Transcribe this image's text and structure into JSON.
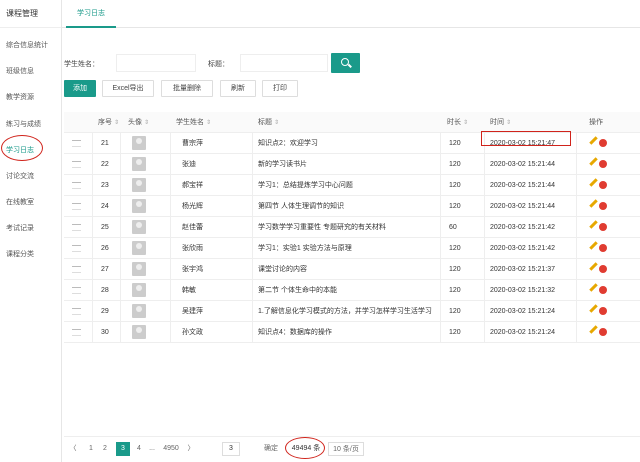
{
  "sidebar": {
    "title": "课程管理",
    "items": [
      {
        "label": "综合信息统计"
      },
      {
        "label": "班级信息"
      },
      {
        "label": "教学资源"
      },
      {
        "label": "练习与成绩"
      },
      {
        "label": "学习日志"
      },
      {
        "label": "讨论交流"
      },
      {
        "label": "在线教室"
      },
      {
        "label": "考试记录"
      },
      {
        "label": "课程分类"
      }
    ],
    "active_index": 4
  },
  "top_tab": {
    "label": "学习日志"
  },
  "search": {
    "student_label": "学生姓名：",
    "title_label": "标题：",
    "student_value": "",
    "title_value": ""
  },
  "toolbar": {
    "add": "添加",
    "excel": "Excel导出",
    "batch_delete": "批量删除",
    "refresh": "刷新",
    "print": "打印"
  },
  "table": {
    "headers": [
      "序号",
      "头像",
      "学生姓名",
      "标题",
      "时长",
      "时间",
      "操作"
    ],
    "rows": [
      {
        "no": "21",
        "name": "曹宗萍",
        "title": "知识点2：欢迎学习",
        "duration": "120",
        "time": "2020-03-02 15:21:47"
      },
      {
        "no": "22",
        "name": "张迪",
        "title": "新的学习读书片",
        "duration": "120",
        "time": "2020-03-02 15:21:44"
      },
      {
        "no": "23",
        "name": "郝宝祥",
        "title": "学习1：总结提炼学习中心问题",
        "duration": "120",
        "time": "2020-03-02 15:21:44"
      },
      {
        "no": "24",
        "name": "杨光辉",
        "title": "第四节 人体生理调节的知识",
        "duration": "120",
        "time": "2020-03-02 15:21:44"
      },
      {
        "no": "25",
        "name": "赵佳蕾",
        "title": "学习数学学习重要性 专题研究的有关材料",
        "duration": "60",
        "time": "2020-03-02 15:21:42"
      },
      {
        "no": "26",
        "name": "张欣雨",
        "title": "学习1：实验1 实验方法与原理",
        "duration": "120",
        "time": "2020-03-02 15:21:42"
      },
      {
        "no": "27",
        "name": "张宇鸿",
        "title": "课堂讨论的内容",
        "duration": "120",
        "time": "2020-03-02 15:21:37"
      },
      {
        "no": "28",
        "name": "韩敏",
        "title": "第二节 个体生命中的本能",
        "duration": "120",
        "time": "2020-03-02 15:21:32"
      },
      {
        "no": "29",
        "name": "吴建萍",
        "title": "1.了解信息化学习模式的方法，并学习怎样学习生活学习",
        "duration": "120",
        "time": "2020-03-02 15:21:24"
      },
      {
        "no": "30",
        "name": "孙文政",
        "title": "知识点4：数据库的操作",
        "duration": "120",
        "time": "2020-03-02 15:21:24"
      }
    ]
  },
  "pagination": {
    "prev": "〈",
    "pages": [
      "1",
      "2",
      "3",
      "4",
      "..."
    ],
    "last_page": "4950",
    "current": "3",
    "next": "〉",
    "goto_value": "3",
    "go_label": "确定",
    "total": "49494 条",
    "per_page": "10 条/页"
  }
}
